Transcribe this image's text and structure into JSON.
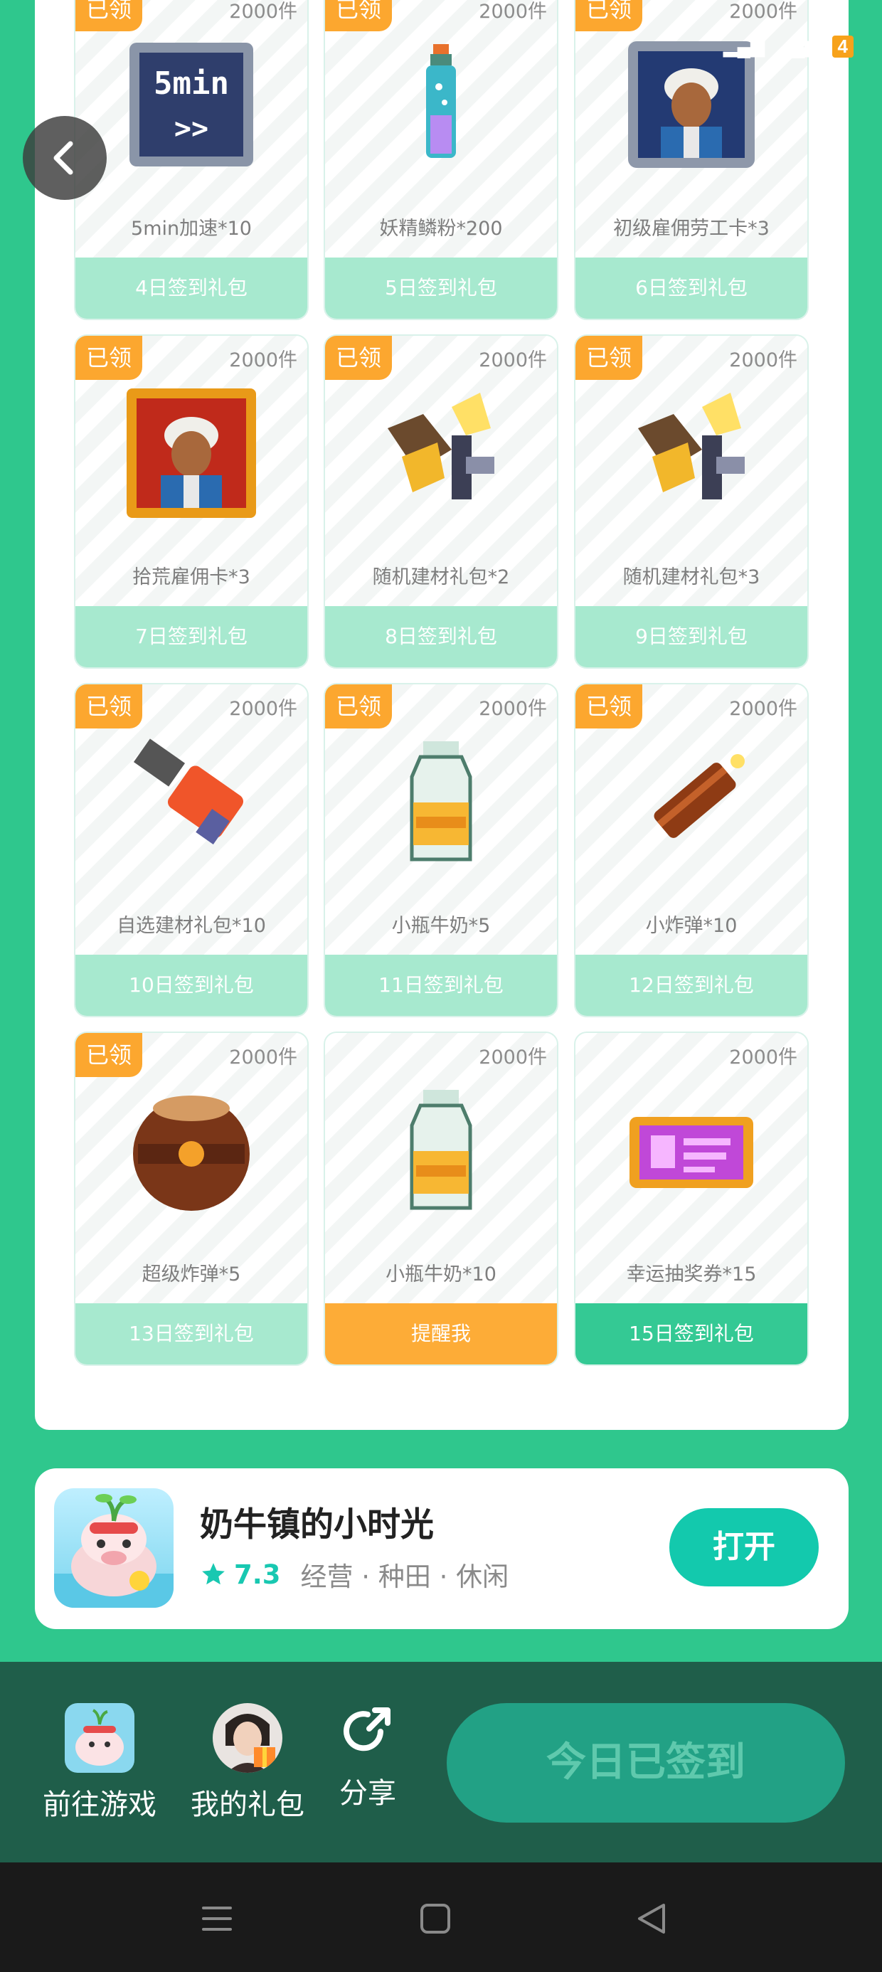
{
  "status_bar": {
    "battery": "4"
  },
  "cards": [
    {
      "claimed": "已领",
      "stock": "2000件",
      "item": "5min加速*10",
      "label": "4日签到礼包",
      "state": "claimed",
      "icon": "speedup-5min-icon",
      "art_text": "5min"
    },
    {
      "claimed": "已领",
      "stock": "2000件",
      "item": "妖精鳞粉*200",
      "label": "5日签到礼包",
      "state": "claimed",
      "icon": "fairy-dust-bottle-icon"
    },
    {
      "claimed": "已领",
      "stock": "2000件",
      "item": "初级雇佣劳工卡*3",
      "label": "6日签到礼包",
      "state": "claimed",
      "icon": "worker-card-icon"
    },
    {
      "claimed": "已领",
      "stock": "2000件",
      "item": "拾荒雇佣卡*3",
      "label": "7日签到礼包",
      "state": "claimed",
      "icon": "scavenger-card-icon"
    },
    {
      "claimed": "已领",
      "stock": "2000件",
      "item": "随机建材礼包*2",
      "label": "8日签到礼包",
      "state": "claimed",
      "icon": "building-materials-icon"
    },
    {
      "claimed": "已领",
      "stock": "2000件",
      "item": "随机建材礼包*3",
      "label": "9日签到礼包",
      "state": "claimed",
      "icon": "building-materials-icon"
    },
    {
      "claimed": "已领",
      "stock": "2000件",
      "item": "自选建材礼包*10",
      "label": "10日签到礼包",
      "state": "claimed",
      "icon": "select-materials-icon"
    },
    {
      "claimed": "已领",
      "stock": "2000件",
      "item": "小瓶牛奶*5",
      "label": "11日签到礼包",
      "state": "claimed",
      "icon": "milk-bottle-icon"
    },
    {
      "claimed": "已领",
      "stock": "2000件",
      "item": "小炸弹*10",
      "label": "12日签到礼包",
      "state": "claimed",
      "icon": "small-bomb-icon"
    },
    {
      "claimed": "已领",
      "stock": "2000件",
      "item": "超级炸弹*5",
      "label": "13日签到礼包",
      "state": "claimed",
      "icon": "super-bomb-icon"
    },
    {
      "claimed": "",
      "stock": "2000件",
      "item": "小瓶牛奶*10",
      "label": "提醒我",
      "state": "remind",
      "icon": "milk-bottle-icon"
    },
    {
      "claimed": "",
      "stock": "2000件",
      "item": "幸运抽奖券*15",
      "label": "15日签到礼包",
      "state": "active",
      "icon": "lottery-ticket-icon"
    }
  ],
  "game": {
    "name": "奶牛镇的小时光",
    "score": "7.3",
    "tags": "经营 · 种田 · 休闲",
    "open": "打开"
  },
  "bottom": {
    "play": "前往游戏",
    "gifts": "我的礼包",
    "share": "分享",
    "signed": "今日已签到"
  }
}
